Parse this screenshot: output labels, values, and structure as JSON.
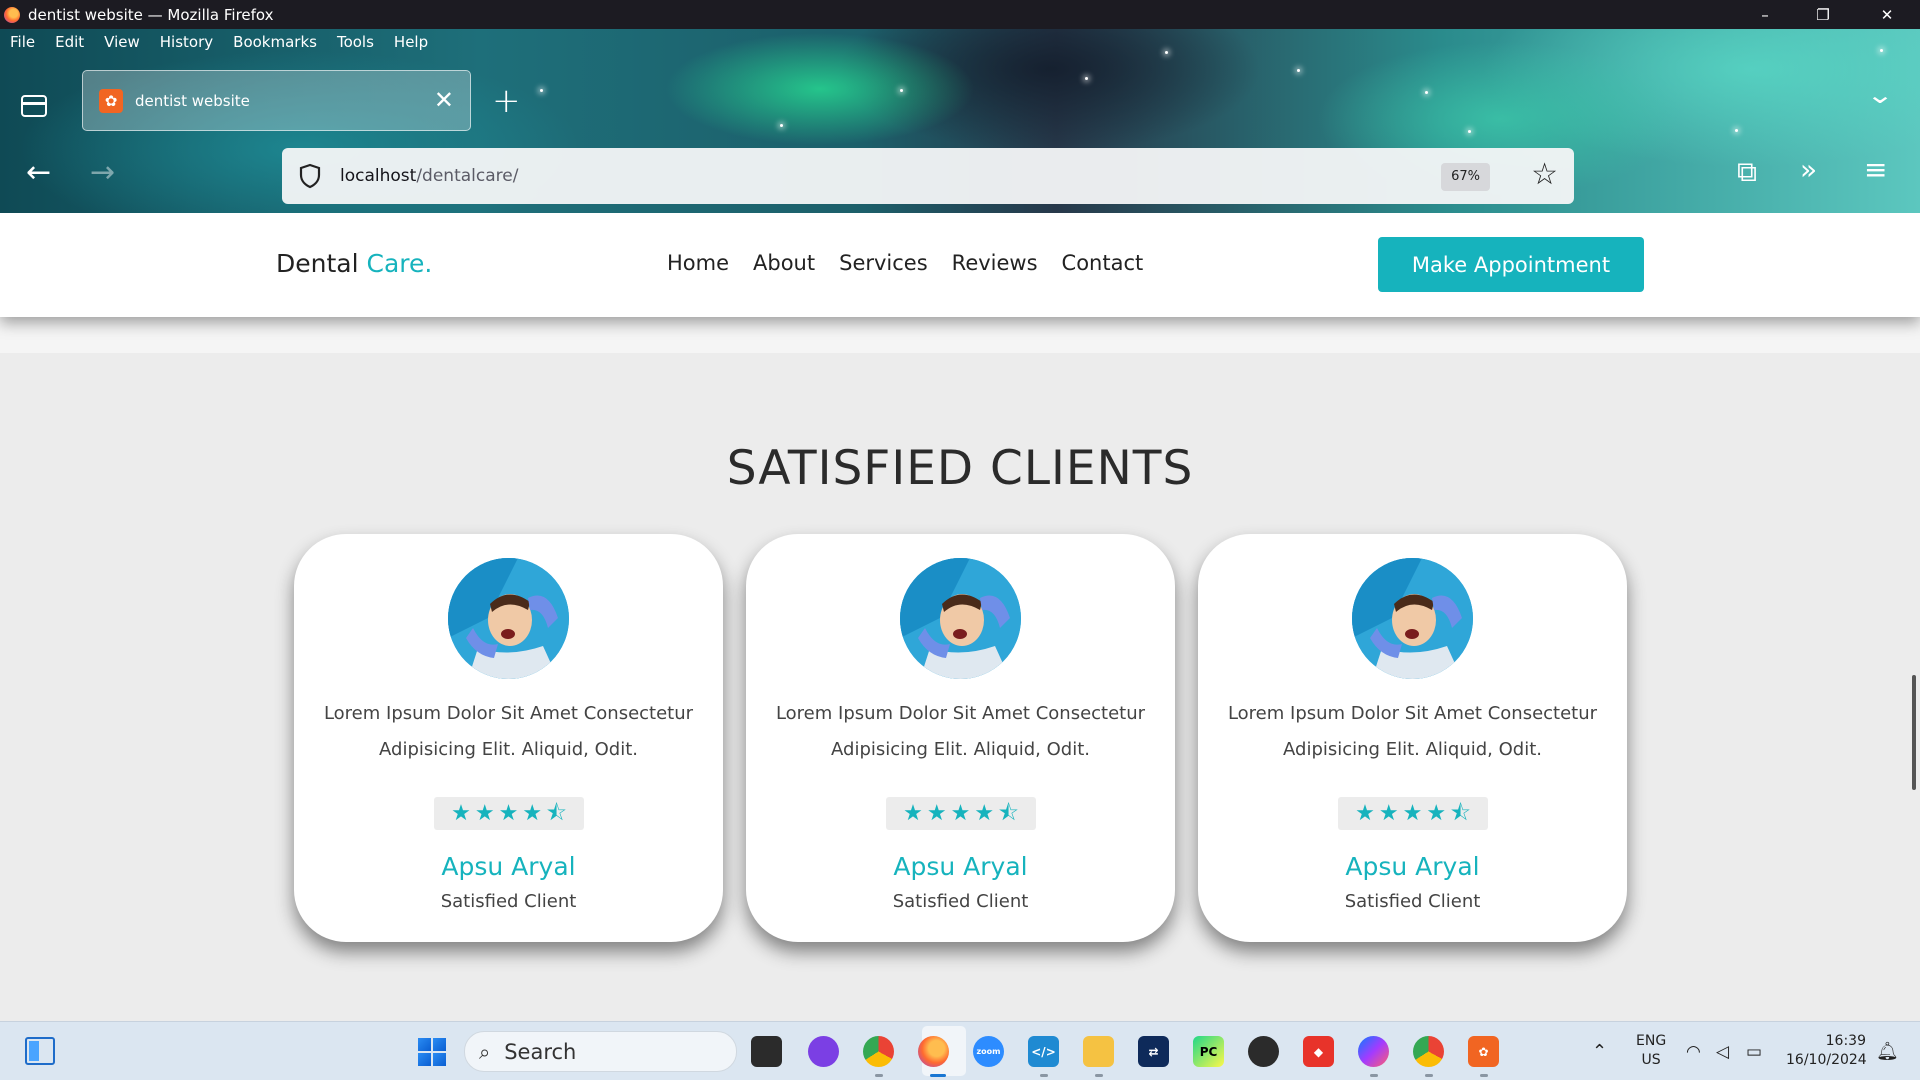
{
  "window": {
    "title": "dentist website — Mozilla Firefox",
    "minimize": "–",
    "restore": "❐",
    "close": "✕"
  },
  "menu": [
    "File",
    "Edit",
    "View",
    "History",
    "Bookmarks",
    "Tools",
    "Help"
  ],
  "tab": {
    "title": "dentist website",
    "favicon": "xampp-icon",
    "close": "✕"
  },
  "toolbar": {
    "new_tab": "+",
    "back": "←",
    "forward": "→",
    "url_host": "localhost",
    "url_path": "/dentalcare/",
    "zoom": "67%",
    "bookmark": "☆",
    "extensions": "⧉",
    "overflow": "»",
    "menu": "≡",
    "tab_list_chevron": "⌄"
  },
  "site": {
    "logo_main": "Dental",
    "logo_accent": "Care.",
    "nav": [
      "Home",
      "About",
      "Services",
      "Reviews",
      "Contact"
    ],
    "cta": "Make Appointment",
    "accent_color": "#16b3bd"
  },
  "section": {
    "title": "SATISFIED CLIENTS"
  },
  "reviews": [
    {
      "text": "Lorem Ipsum Dolor Sit Amet Consectetur Adipisicing Elit. Aliquid, Odit.",
      "rating": 4.5,
      "name": "Apsu Aryal",
      "role": "Satisfied Client"
    },
    {
      "text": "Lorem Ipsum Dolor Sit Amet Consectetur Adipisicing Elit. Aliquid, Odit.",
      "rating": 4.5,
      "name": "Apsu Aryal",
      "role": "Satisfied Client"
    },
    {
      "text": "Lorem Ipsum Dolor Sit Amet Consectetur Adipisicing Elit. Aliquid, Odit.",
      "rating": 4.5,
      "name": "Apsu Aryal",
      "role": "Satisfied Client"
    }
  ],
  "taskbar": {
    "search_placeholder": "Search",
    "lang_1": "ENG",
    "lang_2": "US",
    "time": "16:39",
    "date": "16/10/2024",
    "apps": [
      "task-view",
      "dev-app",
      "chrome",
      "firefox",
      "zoom",
      "vscode",
      "file-explorer",
      "teamviewer",
      "pycharm",
      "obs",
      "anydesk",
      "messenger",
      "chrome-2",
      "xampp"
    ]
  }
}
